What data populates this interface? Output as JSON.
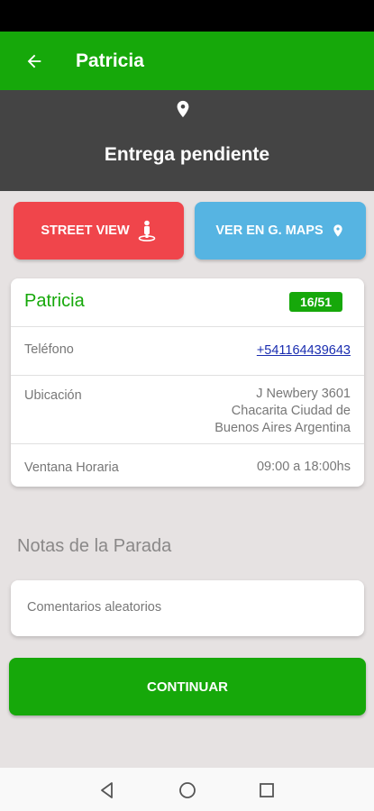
{
  "app_bar": {
    "title": "Patricia",
    "back_icon": "arrow-back-icon"
  },
  "status_panel": {
    "icon": "location-pin-icon",
    "text": "Entrega pendiente"
  },
  "actions": {
    "street_view_label": "STREET VIEW",
    "street_view_icon": "street-view-person-icon",
    "maps_label": "VER EN G. MAPS",
    "maps_icon": "location-pin-icon"
  },
  "card": {
    "name": "Patricia",
    "badge": "16/51",
    "rows": {
      "phone": {
        "label": "Teléfono",
        "value": "+541164439643"
      },
      "location": {
        "label": "Ubicación",
        "value_lines": [
          "J Newbery 3601",
          "Chacarita Ciudad de",
          "Buenos Aires Argentina"
        ]
      },
      "window": {
        "label": "Ventana Horaria",
        "value": "09:00 a 18:00hs"
      }
    }
  },
  "notes": {
    "title": "Notas de la Parada",
    "value": "Comentarios aleatorios"
  },
  "continue_label": "CONTINUAR",
  "colors": {
    "primary": "#16a80a",
    "street_view": "#f0454b",
    "maps": "#56b4e2",
    "status_panel": "#444444",
    "background": "#e6e2e2"
  }
}
